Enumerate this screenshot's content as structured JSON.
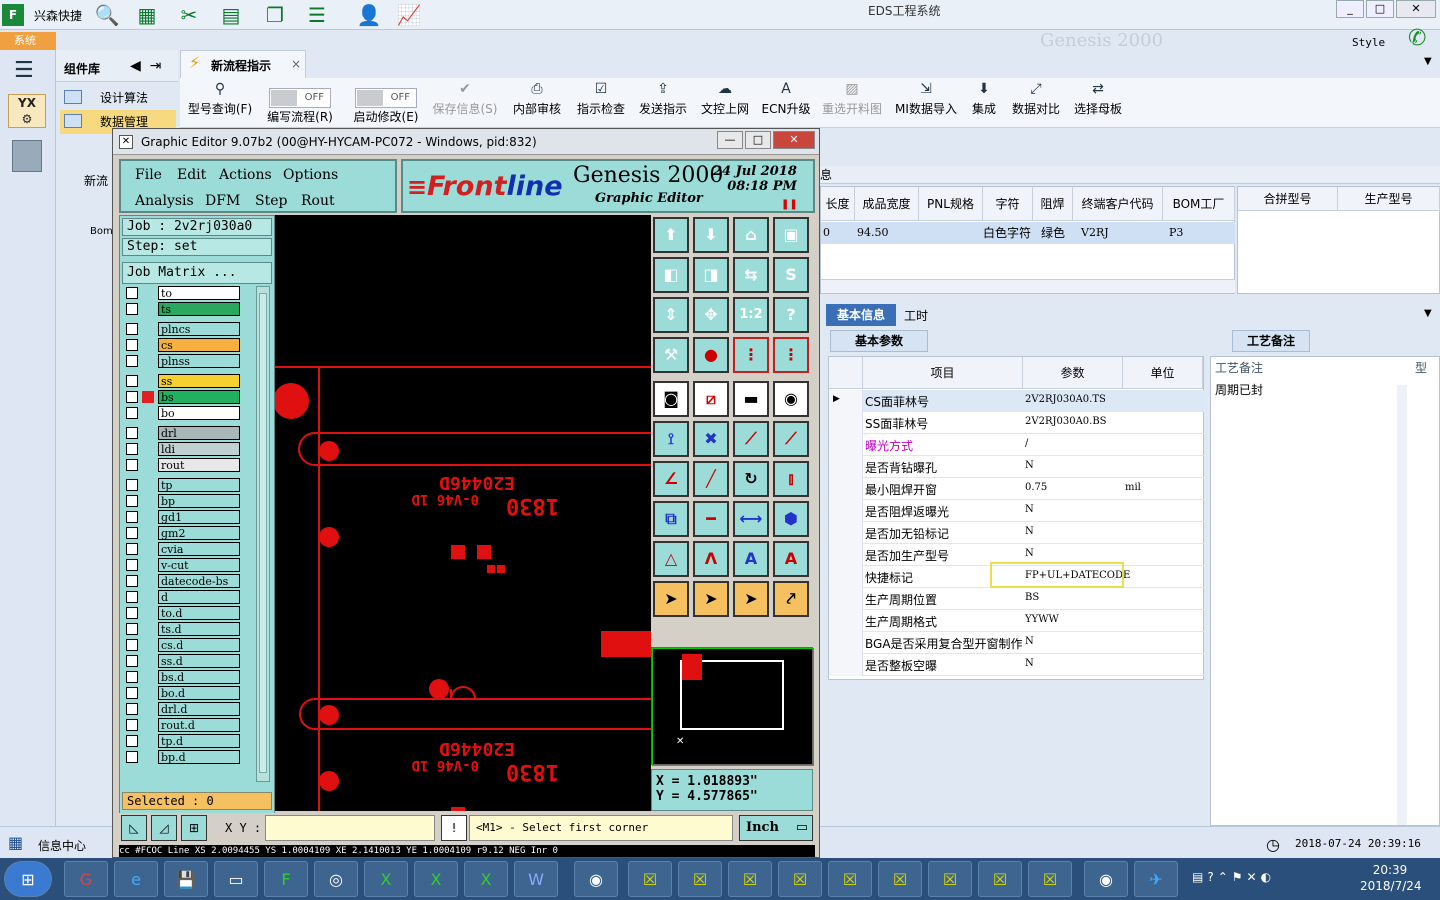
{
  "topbar": {
    "app_name": "兴森快捷",
    "title": "EDS工程系统",
    "style_label": "Style",
    "system_tab": "系统",
    "watermark": "Genesis 2000"
  },
  "component_panel": {
    "title": "组件库",
    "items": [
      {
        "label": "设计算法"
      },
      {
        "label": "数据管理"
      }
    ],
    "partial_labels": [
      "新流",
      "Bom"
    ]
  },
  "doc_tab": {
    "label": "新流程指示",
    "close": "×"
  },
  "ribbon": {
    "items": [
      {
        "label": "型号查询(F)",
        "icon": "search-icon"
      },
      {
        "label": "编写流程(R)",
        "toggle": "OFF"
      },
      {
        "label": "启动修改(E)",
        "toggle": "OFF"
      },
      {
        "label": "保存信息(S)",
        "disabled": true,
        "icon": "check-icon"
      },
      {
        "label": "内部审核",
        "icon": "print-icon"
      },
      {
        "label": "指示检查",
        "icon": "checkbox-icon"
      },
      {
        "label": "发送指示",
        "icon": "upload-icon"
      },
      {
        "label": "文控上网",
        "icon": "cloud-icon"
      },
      {
        "label": "ECN升级",
        "icon": "letter-a-icon"
      },
      {
        "label": "重选开料图",
        "disabled": true,
        "icon": "image-icon"
      },
      {
        "label": "MI数据导入",
        "icon": "import-icon"
      },
      {
        "label": "集成",
        "icon": "download-icon"
      },
      {
        "label": "数据对比",
        "icon": "compare-icon"
      },
      {
        "label": "选择母板",
        "icon": "shuffle-icon"
      }
    ]
  },
  "grid1": {
    "headers": [
      "长度",
      "成品宽度",
      "PNL规格",
      "字符",
      "阻焊",
      "终端客户代码",
      "BOM工厂"
    ],
    "row": [
      "0",
      "94.50",
      "",
      "白色字符",
      "绿色",
      "V2RJ",
      "P3"
    ]
  },
  "grid2": {
    "headers": [
      "合拼型号",
      "生产型号"
    ]
  },
  "lower": {
    "tab_basic": "基本信息",
    "tab_work": "工时",
    "sub_basic": "基本参数",
    "sub_memo": "工艺备注",
    "partial_header": "息"
  },
  "params": {
    "headers": [
      "项目",
      "参数",
      "单位"
    ],
    "rows": [
      {
        "k": "CS面菲林号",
        "v": "2V2RJ030A0.TS",
        "u": ""
      },
      {
        "k": "SS面菲林号",
        "v": "2V2RJ030A0.BS",
        "u": ""
      },
      {
        "k": "曝光方式",
        "v": "/",
        "u": ""
      },
      {
        "k": "是否背钻曝孔",
        "v": "N",
        "u": ""
      },
      {
        "k": "最小阻焊开窗",
        "v": "0.75",
        "u": "mil"
      },
      {
        "k": "是否阻焊返曝光",
        "v": "N",
        "u": ""
      },
      {
        "k": "是否加无铅标记",
        "v": "N",
        "u": ""
      },
      {
        "k": "是否加生产型号",
        "v": "N",
        "u": ""
      },
      {
        "k": "快捷标记",
        "v": "FP+UL+DATECODE",
        "u": ""
      },
      {
        "k": "生产周期位置",
        "v": "BS",
        "u": ""
      },
      {
        "k": "生产周期格式",
        "v": "YYWW",
        "u": ""
      },
      {
        "k": "BGA是否采用复合型开窗制作",
        "v": "N",
        "u": ""
      },
      {
        "k": "是否整板空曝",
        "v": "N",
        "u": ""
      }
    ]
  },
  "memo": {
    "header": "工艺备注",
    "header2": "型",
    "value": "周期已封"
  },
  "statusbar": {
    "info_center": "信息中心",
    "datetime": "2018-07-24 20:39:16"
  },
  "tray": {
    "time": "20:39",
    "date": "2018/7/24"
  },
  "genesis": {
    "title": "Graphic Editor 9.07b2 (00@HY-HYCAM-PC072 - Windows, pid:832)",
    "menu": [
      "File",
      "Edit",
      "Actions",
      "Options",
      "Analysis",
      "DFM",
      "Step",
      "Rout"
    ],
    "logo": {
      "frontline_a": "Front",
      "frontline_b": "line",
      "product": "Genesis 2000",
      "subtitle": "Graphic Editor",
      "date": "24 Jul 2018",
      "time": "08:18 PM"
    },
    "job": "Job : 2v2rj030a0",
    "step": "Step: set",
    "job_matrix": "Job Matrix ...",
    "layers": [
      "to",
      "ts",
      "plncs",
      "cs",
      "plnss",
      "ss",
      "bs",
      "bo",
      "drl",
      "ldi",
      "rout",
      "tp",
      "bp",
      "gd1",
      "gm2",
      "cvia",
      "v-cut",
      "datecode-bs",
      "d",
      "to.d",
      "ts.d",
      "cs.d",
      "ss.d",
      "bs.d",
      "bo.d",
      "drl.d",
      "rout.d",
      "tp.d",
      "bp.d"
    ],
    "selected": "Selected : 0",
    "xy_label": "X Y :",
    "prompt": "<M1> - Select first corner",
    "unit": "Inch",
    "coord_x": "X = 1.018893\"",
    "coord_y": "Y = 4.577865\"",
    "status_line": "cc #FCOC Line XS 2.0094455 YS 1.0004109 XE 2.1410013 YE 1.0004109 r9.12 NEG Inr 0",
    "pcb_texts": [
      "E20446D",
      "0-V46 1D",
      "1830"
    ]
  }
}
